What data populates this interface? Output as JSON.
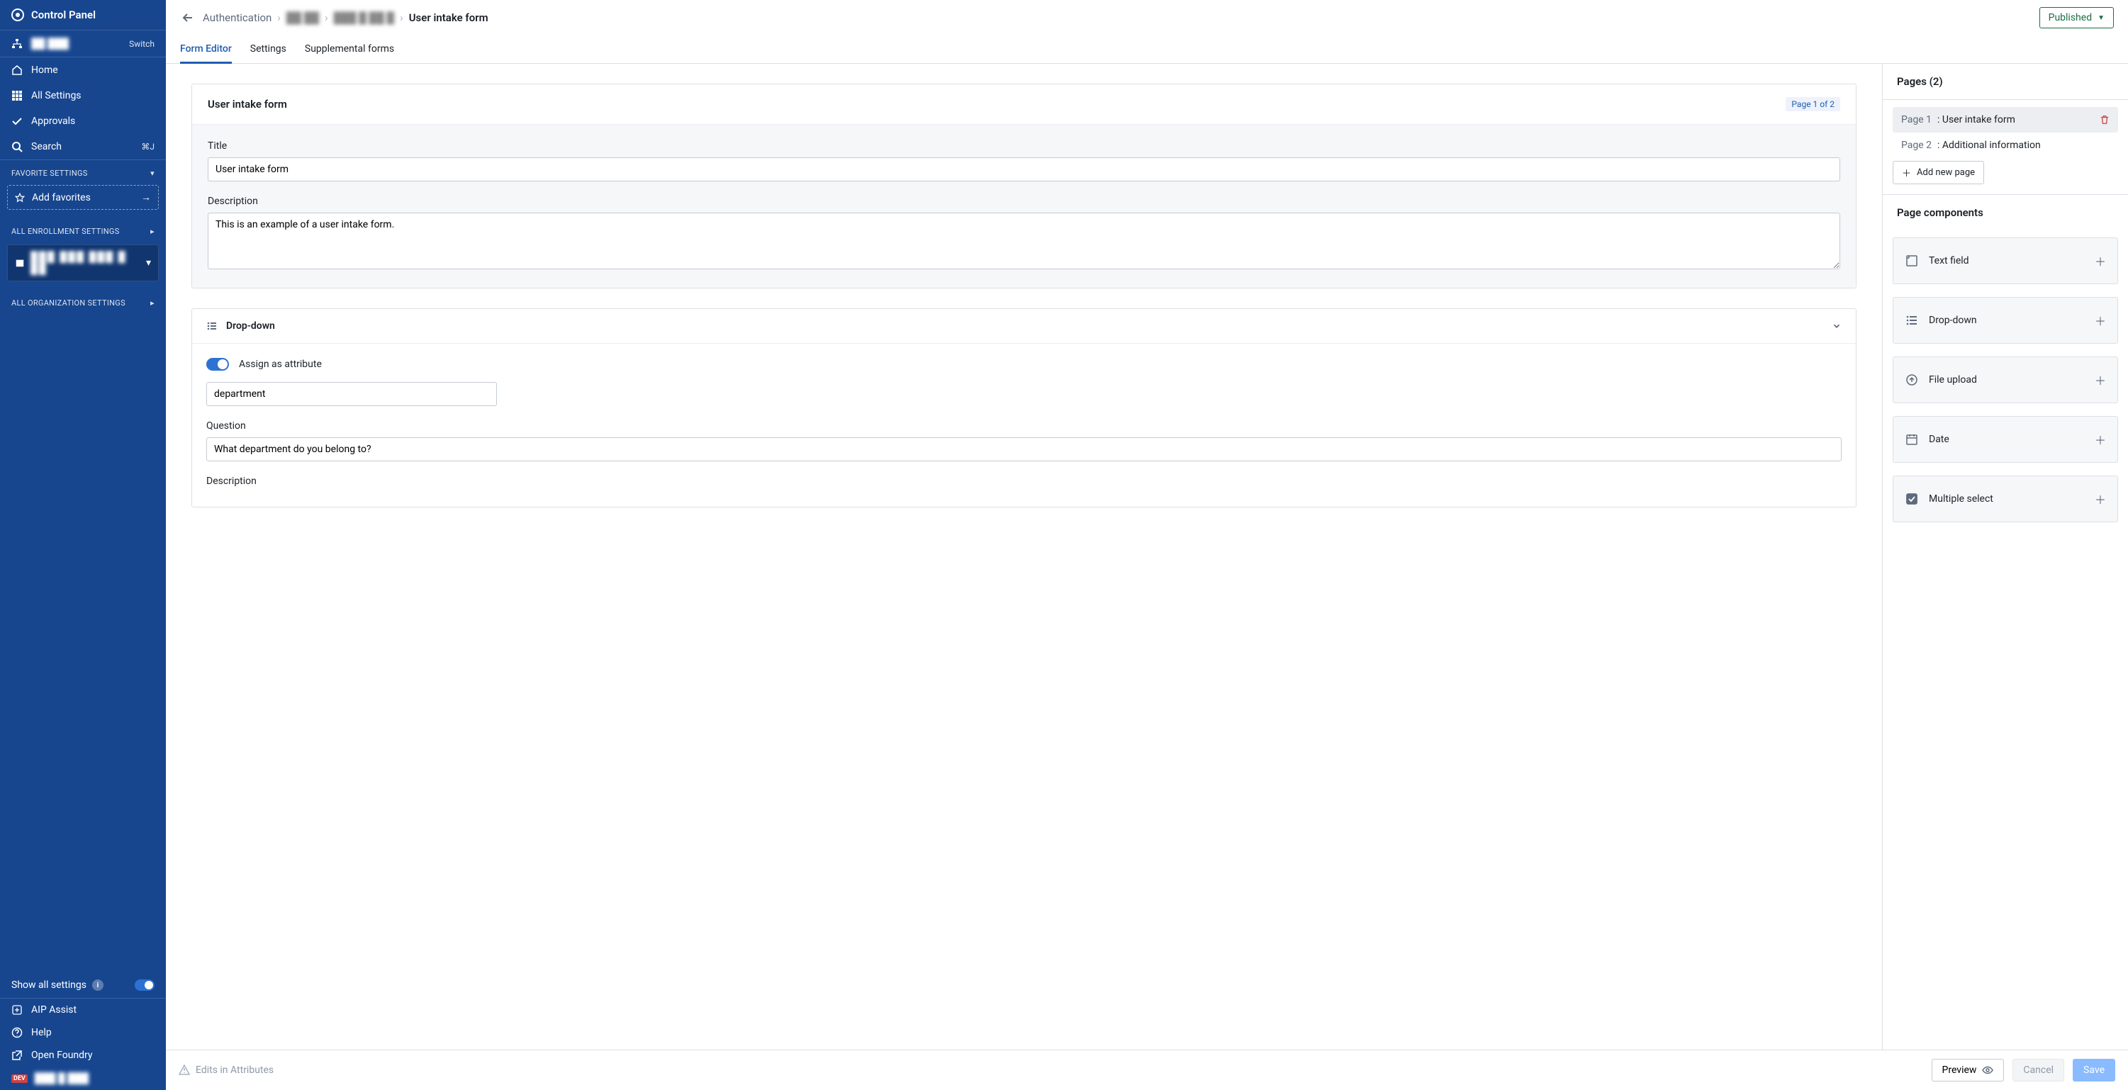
{
  "brand": "Control Panel",
  "sidebar": {
    "switch": "Switch",
    "nav": [
      {
        "icon": "home",
        "label": "Home"
      },
      {
        "icon": "grid",
        "label": "All Settings"
      },
      {
        "icon": "check",
        "label": "Approvals"
      },
      {
        "icon": "search",
        "label": "Search",
        "shortcut": "⌘J"
      }
    ],
    "fav_header": "FAVORITE SETTINGS",
    "add_fav": "Add favorites",
    "enroll_header": "ALL ENROLLMENT SETTINGS",
    "org_header": "ALL ORGANIZATION SETTINGS",
    "show_all": "Show all settings",
    "bottom": [
      {
        "icon": "sparkle",
        "label": "AIP Assist"
      },
      {
        "icon": "help",
        "label": "Help"
      },
      {
        "icon": "open",
        "label": "Open Foundry"
      }
    ],
    "dev": "DEV"
  },
  "breadcrumbs": {
    "items": [
      "Authentication",
      "",
      "",
      "User intake form"
    ],
    "current": "User intake form"
  },
  "status_button": "Published",
  "tabs": [
    "Form Editor",
    "Settings",
    "Supplemental forms"
  ],
  "form_card": {
    "title": "User intake form",
    "page_badge": "Page 1 of 2",
    "title_label": "Title",
    "title_value": "User intake form",
    "desc_label": "Description",
    "desc_value": "This is an example of a user intake form."
  },
  "dropdown_card": {
    "header": "Drop-down",
    "assign_label": "Assign as attribute",
    "attr_value": "department",
    "question_label": "Question",
    "question_value": "What department do you belong to?",
    "desc_label": "Description"
  },
  "right": {
    "pages_header": "Pages (2)",
    "pages": [
      {
        "prefix": "Page 1",
        "name": ": User intake form",
        "active": true
      },
      {
        "prefix": "Page 2",
        "name": ": Additional information",
        "active": false
      }
    ],
    "add_page": "Add new page",
    "components_header": "Page components",
    "components": [
      {
        "icon": "textfield",
        "label": "Text field"
      },
      {
        "icon": "dropdown",
        "label": "Drop-down"
      },
      {
        "icon": "upload",
        "label": "File upload"
      },
      {
        "icon": "date",
        "label": "Date"
      },
      {
        "icon": "multi",
        "label": "Multiple select"
      }
    ]
  },
  "footer": {
    "hint": "Edits in Attributes",
    "preview": "Preview",
    "cancel": "Cancel",
    "save": "Save"
  },
  "colors": {
    "primary": "#215db0",
    "sidebar": "#17468f",
    "green": "#1c6e42",
    "danger": "#cd4246"
  }
}
